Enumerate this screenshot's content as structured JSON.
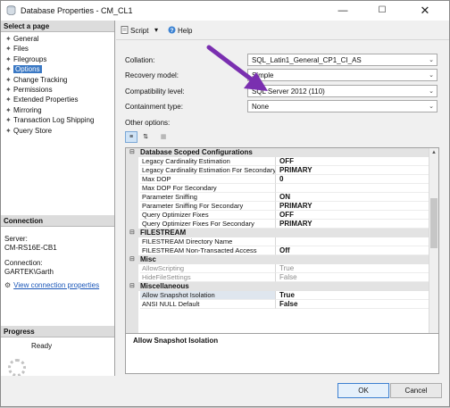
{
  "window": {
    "title": "Database Properties - CM_CL1"
  },
  "left": {
    "select_page_header": "Select a page",
    "pages": [
      {
        "label": "General"
      },
      {
        "label": "Files"
      },
      {
        "label": "Filegroups"
      },
      {
        "label": "Options",
        "selected": true
      },
      {
        "label": "Change Tracking"
      },
      {
        "label": "Permissions"
      },
      {
        "label": "Extended Properties"
      },
      {
        "label": "Mirroring"
      },
      {
        "label": "Transaction Log Shipping"
      },
      {
        "label": "Query Store"
      }
    ],
    "connection_header": "Connection",
    "server_label": "Server:",
    "server_value": "CM-RS16E-CB1",
    "connection_label": "Connection:",
    "connection_value": "GARTEK\\Garth",
    "view_link": "View connection properties",
    "progress_header": "Progress",
    "progress_status": "Ready"
  },
  "toolbar": {
    "script_label": "Script",
    "help_label": "Help"
  },
  "fields": [
    {
      "label": "Collation:",
      "value": "SQL_Latin1_General_CP1_CI_AS"
    },
    {
      "label": "Recovery model:",
      "value": "Simple"
    },
    {
      "label": "Compatibility level:",
      "value": "SQL Server 2012 (110)"
    },
    {
      "label": "Containment type:",
      "value": "None"
    }
  ],
  "other_options_label": "Other options:",
  "grid": [
    {
      "category": "Database Scoped Configurations"
    },
    {
      "name": "Legacy Cardinality Estimation",
      "value": "OFF"
    },
    {
      "name": "Legacy Cardinality Estimation For Secondary",
      "value": "PRIMARY"
    },
    {
      "name": "Max DOP",
      "value": "0"
    },
    {
      "name": "Max DOP For Secondary",
      "value": ""
    },
    {
      "name": "Parameter Sniffing",
      "value": "ON"
    },
    {
      "name": "Parameter Sniffing For Secondary",
      "value": "PRIMARY"
    },
    {
      "name": "Query Optimizer Fixes",
      "value": "OFF"
    },
    {
      "name": "Query Optimizer Fixes For Secondary",
      "value": "PRIMARY"
    },
    {
      "category": "FILESTREAM"
    },
    {
      "name": "FILESTREAM Directory Name",
      "value": ""
    },
    {
      "name": "FILESTREAM Non-Transacted Access",
      "value": "Off"
    },
    {
      "category": "Misc"
    },
    {
      "name": "AllowScripting",
      "value": "True",
      "disabled": true
    },
    {
      "name": "HideFileSettings",
      "value": "False",
      "disabled": true
    },
    {
      "category": "Miscellaneous"
    },
    {
      "name": "Allow Snapshot Isolation",
      "value": "True",
      "selected": true
    },
    {
      "name": "ANSI NULL Default",
      "value": "False"
    }
  ],
  "description_text": "Allow Snapshot Isolation",
  "buttons": {
    "ok": "OK",
    "cancel": "Cancel"
  },
  "colors": {
    "accent": "#3a78c4",
    "annotation_arrow": "#7a2fb0"
  }
}
